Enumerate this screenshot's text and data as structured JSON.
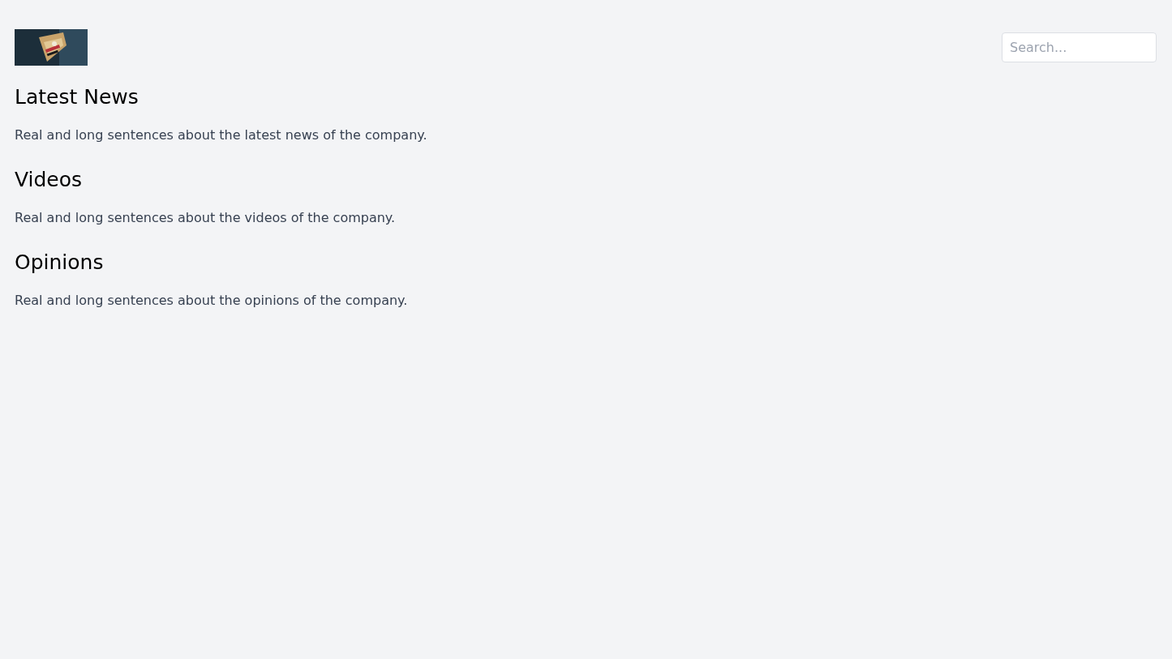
{
  "header": {
    "search": {
      "placeholder": "Search..."
    }
  },
  "sections": [
    {
      "title": "Latest News",
      "text": "Real and long sentences about the latest news of the company."
    },
    {
      "title": "Videos",
      "text": "Real and long sentences about the videos of the company."
    },
    {
      "title": "Opinions",
      "text": "Real and long sentences about the opinions of the company."
    }
  ]
}
